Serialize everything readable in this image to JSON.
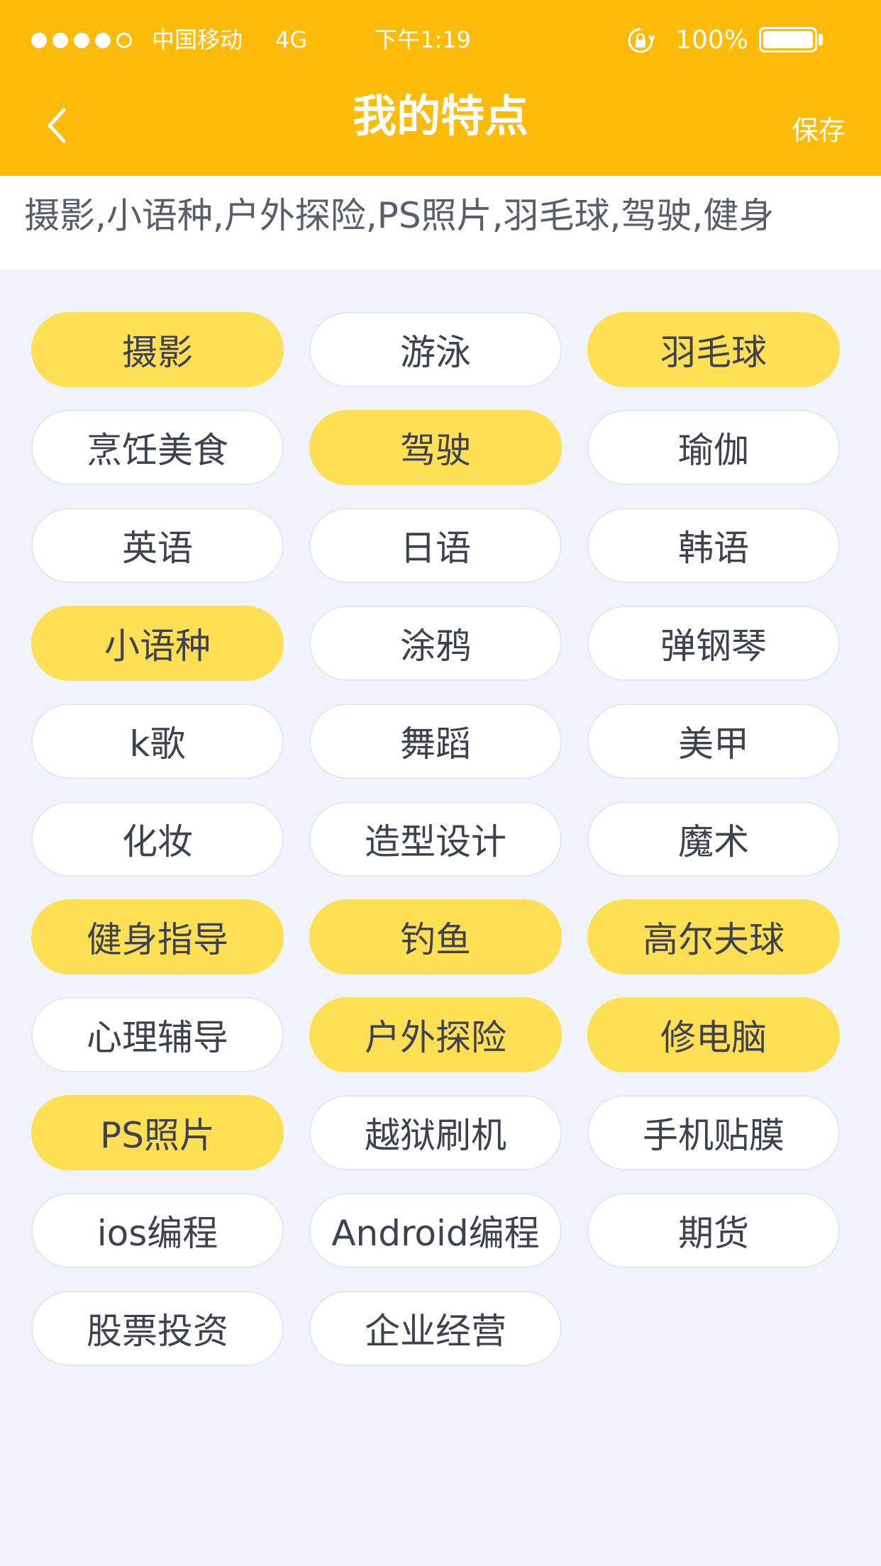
{
  "status_bar": {
    "signal_dots": [
      true,
      true,
      true,
      true,
      false
    ],
    "carrier": "中国移动",
    "network": "4G",
    "time": "下午1:19",
    "battery_percent": "100%",
    "battery_level": 1.0
  },
  "nav": {
    "title": "我的特点",
    "save_label": "保存",
    "back_icon": "chevron-left-icon"
  },
  "summary": {
    "text": "摄影,小语种,户外探险,PS照片,羽毛球,驾驶,健身"
  },
  "colors": {
    "header_bg": "#FFBB0A",
    "selected_tag_bg": "#FFE055",
    "tag_bg": "#FFFFFF",
    "page_bg": "#F0F3FA"
  },
  "tags": [
    {
      "label": "摄影",
      "selected": true
    },
    {
      "label": "游泳",
      "selected": false
    },
    {
      "label": "羽毛球",
      "selected": true
    },
    {
      "label": "烹饪美食",
      "selected": false
    },
    {
      "label": "驾驶",
      "selected": true
    },
    {
      "label": "瑜伽",
      "selected": false
    },
    {
      "label": "英语",
      "selected": false
    },
    {
      "label": "日语",
      "selected": false
    },
    {
      "label": "韩语",
      "selected": false
    },
    {
      "label": "小语种",
      "selected": true
    },
    {
      "label": "涂鸦",
      "selected": false
    },
    {
      "label": "弹钢琴",
      "selected": false
    },
    {
      "label": "k歌",
      "selected": false
    },
    {
      "label": "舞蹈",
      "selected": false
    },
    {
      "label": "美甲",
      "selected": false
    },
    {
      "label": "化妆",
      "selected": false
    },
    {
      "label": "造型设计",
      "selected": false
    },
    {
      "label": "魔术",
      "selected": false
    },
    {
      "label": "健身指导",
      "selected": true
    },
    {
      "label": "钓鱼",
      "selected": true
    },
    {
      "label": "高尔夫球",
      "selected": true
    },
    {
      "label": "心理辅导",
      "selected": false
    },
    {
      "label": "户外探险",
      "selected": true
    },
    {
      "label": "修电脑",
      "selected": true
    },
    {
      "label": "PS照片",
      "selected": true
    },
    {
      "label": "越狱刷机",
      "selected": false
    },
    {
      "label": "手机贴膜",
      "selected": false
    },
    {
      "label": "ios编程",
      "selected": false
    },
    {
      "label": "Android编程",
      "selected": false
    },
    {
      "label": "期货",
      "selected": false
    },
    {
      "label": "股票投资",
      "selected": false
    },
    {
      "label": "企业经营",
      "selected": false
    }
  ]
}
